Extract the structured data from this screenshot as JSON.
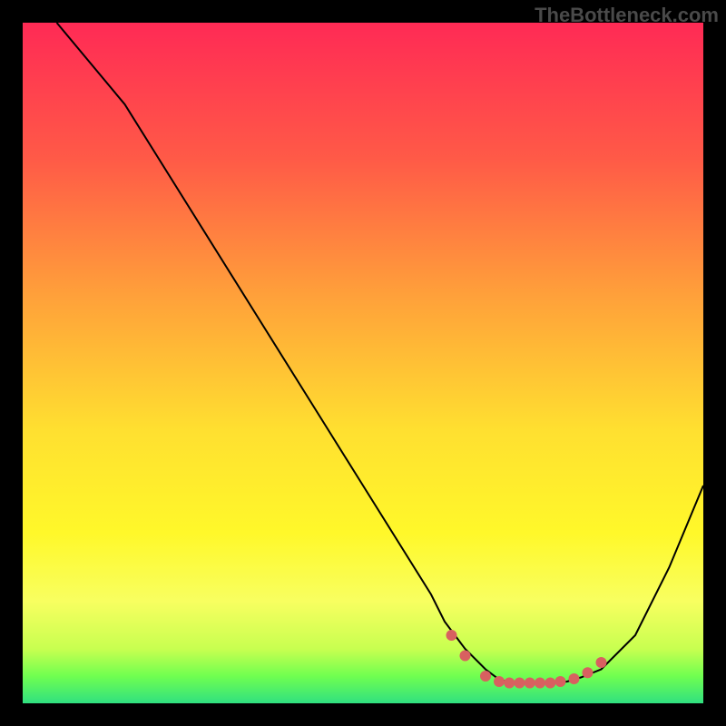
{
  "watermark": "TheBottleneck.com",
  "chart_data": {
    "type": "line",
    "title": "",
    "xlabel": "",
    "ylabel": "",
    "xlim": [
      0,
      100
    ],
    "ylim": [
      0,
      100
    ],
    "gradient_background": {
      "stops": [
        {
          "offset": 0,
          "color": "#ff2a55"
        },
        {
          "offset": 20,
          "color": "#ff5a47"
        },
        {
          "offset": 40,
          "color": "#ffa03a"
        },
        {
          "offset": 60,
          "color": "#ffe030"
        },
        {
          "offset": 75,
          "color": "#fff82a"
        },
        {
          "offset": 85,
          "color": "#f8ff60"
        },
        {
          "offset": 92,
          "color": "#c8ff50"
        },
        {
          "offset": 96,
          "color": "#70ff50"
        },
        {
          "offset": 100,
          "color": "#30e080"
        }
      ]
    },
    "series": [
      {
        "name": "bottleneck-curve",
        "x": [
          5,
          10,
          15,
          20,
          25,
          30,
          35,
          40,
          45,
          50,
          55,
          60,
          62,
          65,
          68,
          70,
          72,
          75,
          78,
          80,
          82,
          85,
          90,
          95,
          100
        ],
        "y": [
          100,
          94,
          88,
          80,
          72,
          64,
          56,
          48,
          40,
          32,
          24,
          16,
          12,
          8,
          5,
          3.5,
          3,
          3,
          3,
          3.2,
          3.8,
          5,
          10,
          20,
          32
        ]
      }
    ],
    "markers": {
      "name": "optimal-range-dots",
      "color": "#d86060",
      "points": [
        {
          "x": 63,
          "y": 10
        },
        {
          "x": 65,
          "y": 7
        },
        {
          "x": 68,
          "y": 4
        },
        {
          "x": 70,
          "y": 3.2
        },
        {
          "x": 71.5,
          "y": 3
        },
        {
          "x": 73,
          "y": 3
        },
        {
          "x": 74.5,
          "y": 3
        },
        {
          "x": 76,
          "y": 3
        },
        {
          "x": 77.5,
          "y": 3
        },
        {
          "x": 79,
          "y": 3.2
        },
        {
          "x": 81,
          "y": 3.6
        },
        {
          "x": 83,
          "y": 4.5
        },
        {
          "x": 85,
          "y": 6
        }
      ]
    }
  }
}
